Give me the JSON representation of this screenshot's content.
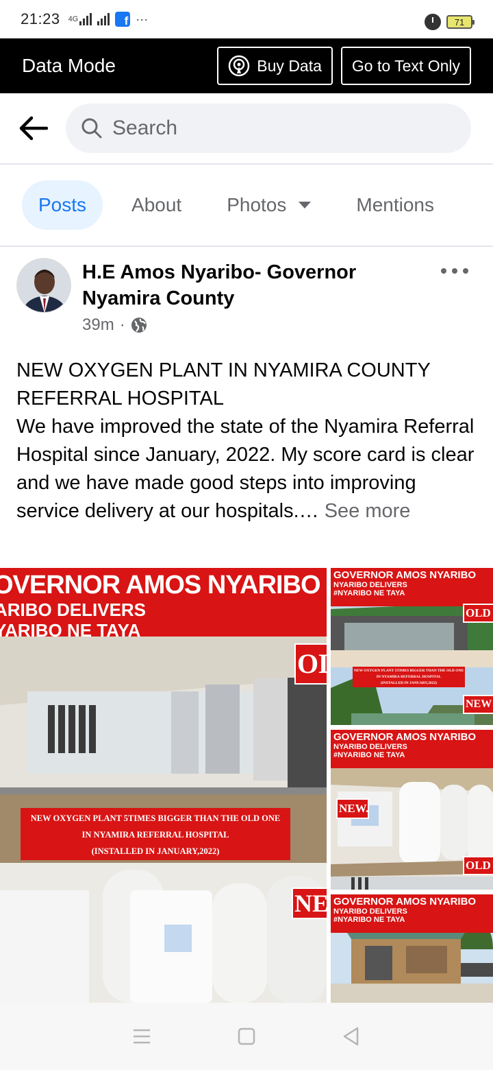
{
  "status_bar": {
    "time": "21:23",
    "network": "4G",
    "battery": "71"
  },
  "data_mode_bar": {
    "title": "Data Mode",
    "buy_data_label": "Buy Data",
    "text_only_label": "Go to Text Only"
  },
  "search": {
    "placeholder": "Search"
  },
  "tabs": [
    {
      "label": "Posts",
      "active": true
    },
    {
      "label": "About",
      "active": false
    },
    {
      "label": "Photos",
      "active": false
    },
    {
      "label": "Mentions",
      "active": false
    }
  ],
  "post": {
    "author": "H.E Amos Nyaribo- Governor Nyamira County",
    "time": "39m",
    "privacy_icon": "globe-icon",
    "text_line1": "NEW OXYGEN PLANT IN NYAMIRA COUNTY REFERRAL HOSPITAL",
    "text_body": "We have improved the state of the Nyamira Referral Hospital since January, 2022. My score card is clear and we have made good steps into  improving service delivery at our hospitals.… ",
    "see_more": "See more"
  },
  "photos": {
    "big": {
      "banner_line1": "OVERNOR AMOS NYARIBO",
      "banner_line2": "ARIBO DELIVERS",
      "banner_line3": "YARIBO NE TAYA",
      "caption_line1": "NEW OXYGEN PLANT 5TIMES BIGGER THAN THE OLD ONE",
      "caption_line2": "IN NYAMIRA REFERRAL HOSPITAL",
      "caption_line3": "(INSTALLED IN JANUARY,2022)",
      "tag_old": "OL",
      "tag_new": "NE"
    },
    "small": {
      "banner_line1": "GOVERNOR AMOS NYARIBO",
      "banner_line2": "NYARIBO DELIVERS",
      "banner_line3": "#NYARIBO NE TAYA",
      "tag_old": "OLD",
      "tag_new": "NEW",
      "tag_new_2": "NEW.",
      "caption_line1": "NEW OXYGEN PLANT 5TIMES BIGGER THAN THE OLD ONE",
      "caption_line2": "IN NYAMIRA REFERRAL HOSPITAL",
      "caption_line3": "(INSTALLED IN JANUARY,2022)"
    }
  },
  "colors": {
    "facebook_blue": "#1877f2",
    "banner_red": "#d81414",
    "active_tab_bg": "#e7f3ff"
  }
}
